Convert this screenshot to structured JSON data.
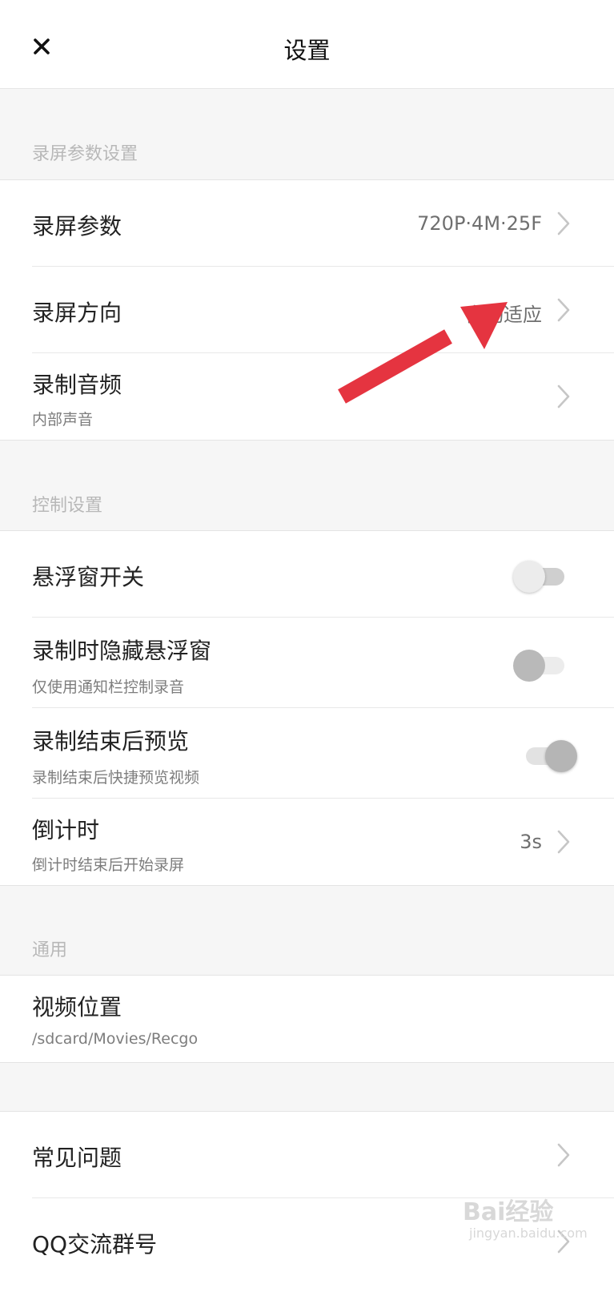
{
  "header": {
    "title": "设置"
  },
  "sections": {
    "record_params": {
      "header": "录屏参数设置",
      "rows": {
        "params": {
          "label": "录屏参数",
          "value": "720P·4M·25F"
        },
        "orientation": {
          "label": "录屏方向",
          "value": "自动适应"
        },
        "audio": {
          "label": "录制音频",
          "sub": "内部声音"
        }
      }
    },
    "control": {
      "header": "控制设置",
      "rows": {
        "float_window": {
          "label": "悬浮窗开关",
          "toggle": false
        },
        "hide_float": {
          "label": "录制时隐藏悬浮窗",
          "sub": "仅使用通知栏控制录音",
          "toggle": false
        },
        "preview": {
          "label": "录制结束后预览",
          "sub": "录制结束后快捷预览视频",
          "toggle": true
        },
        "countdown": {
          "label": "倒计时",
          "sub": "倒计时结束后开始录屏",
          "value": "3s"
        }
      }
    },
    "general": {
      "header": "通用",
      "rows": {
        "video_location": {
          "label": "视频位置",
          "sub": "/sdcard/Movies/Recgo"
        }
      }
    },
    "misc": {
      "rows": {
        "faq": {
          "label": "常见问题"
        },
        "qq_group": {
          "label": "QQ交流群号"
        }
      }
    }
  },
  "watermark": {
    "line1": "Bai经验",
    "line2": "jingyan.baidu.com"
  },
  "colors": {
    "annotation_arrow": "#e53440",
    "toggle_off": "#e8e8e8",
    "toggle_on": "#b5b5b5"
  }
}
